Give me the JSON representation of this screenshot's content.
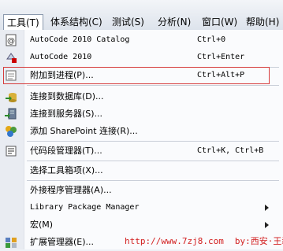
{
  "menubar": {
    "items": [
      "工具(T)",
      "体系结构(C)",
      "测试(S)",
      "分析(N)",
      "窗口(W)",
      "帮助(H)"
    ]
  },
  "menu": {
    "items": [
      {
        "label": "AutoCode 2010 Catalog",
        "shortcut": "Ctrl+0",
        "icon": "autocode-catalog-icon"
      },
      {
        "label": "AutoCode 2010",
        "shortcut": "Ctrl+Enter",
        "icon": "autocode-icon"
      },
      {
        "label": "附加到进程(P)...",
        "shortcut": "Ctrl+Alt+P",
        "icon": "attach-process-icon"
      },
      {
        "label": "连接到数据库(D)...",
        "shortcut": "",
        "icon": "connect-database-icon"
      },
      {
        "label": "连接到服务器(S)...",
        "shortcut": "",
        "icon": "connect-server-icon"
      },
      {
        "label": "添加 SharePoint 连接(R)...",
        "shortcut": "",
        "icon": "sharepoint-icon"
      },
      {
        "label": "代码段管理器(T)...",
        "shortcut": "Ctrl+K, Ctrl+B",
        "icon": "code-snippet-icon"
      },
      {
        "label": "选择工具箱项(X)...",
        "shortcut": "",
        "icon": ""
      },
      {
        "label": "外接程序管理器(A)...",
        "shortcut": "",
        "icon": ""
      },
      {
        "label": "Library Package Manager",
        "shortcut": "",
        "icon": ""
      },
      {
        "label": "宏(M)",
        "shortcut": "",
        "icon": ""
      },
      {
        "label": "扩展管理器(E)...",
        "shortcut": "",
        "icon": "extension-manager-icon"
      }
    ]
  },
  "watermark": {
    "url": "http://www.7zj8.com",
    "by": "by:西安·王磊"
  }
}
